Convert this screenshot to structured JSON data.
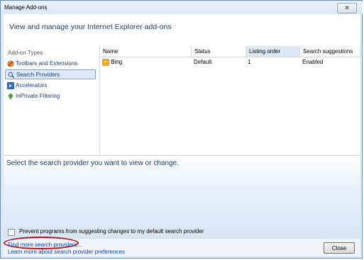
{
  "window": {
    "title": "Manage Add-ons",
    "close_glyph": "✕"
  },
  "header": {
    "text": "View and manage your Internet Explorer add-ons"
  },
  "sidebar": {
    "title": "Add-on Types",
    "items": [
      {
        "label": "Toolbars and Extensions",
        "icon": "toolbars-icon",
        "selected": false
      },
      {
        "label": "Search Providers",
        "icon": "search-icon",
        "selected": true
      },
      {
        "label": "Accelerators",
        "icon": "accelerators-icon",
        "selected": false
      },
      {
        "label": "InPrivate Filtering",
        "icon": "inprivate-icon",
        "selected": false
      }
    ]
  },
  "list": {
    "columns": [
      "Name",
      "Status",
      "Listing order",
      "Search suggestions"
    ],
    "rows": [
      {
        "name": "Bing",
        "status": "Default",
        "order": "1",
        "suggestions": "Enabled"
      }
    ]
  },
  "detail": {
    "text": "Select the search provider you want to view or change.",
    "checkbox_label": "Prevent programs from suggesting changes to my default search provider",
    "checkbox_checked": false
  },
  "footer": {
    "find_more_link": "Find more search providers...",
    "learn_more_link": "Learn more about search provider preferences",
    "close_button": "Close"
  },
  "colors": {
    "accent": "#1e395b",
    "link": "#0645c4",
    "highlight_oval": "#b8101a"
  }
}
